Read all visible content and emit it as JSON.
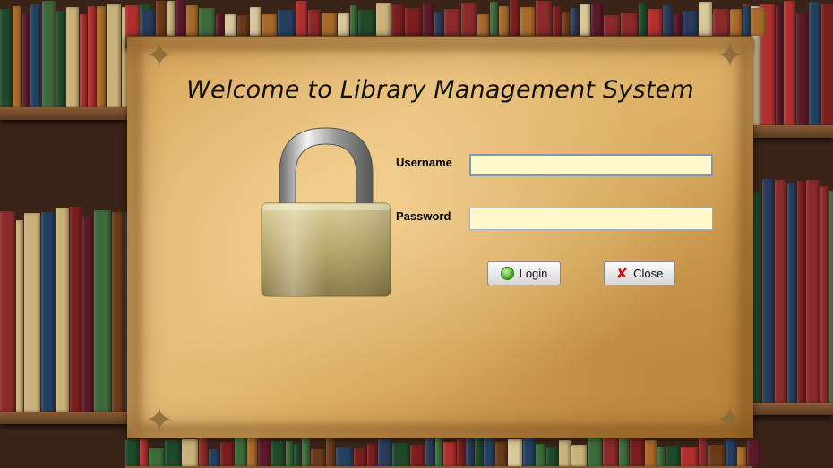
{
  "window": {
    "title": "Welcome to Library Management System"
  },
  "form": {
    "username_label": "Username",
    "username_value": "",
    "password_label": "Password",
    "password_value": ""
  },
  "buttons": {
    "login_label": "Login",
    "login_icon": "green-circle-icon",
    "close_label": "Close",
    "close_icon": "red-x-icon"
  },
  "colors": {
    "input_background": "#fff8c8",
    "parchment": "#dcae64",
    "title_text": "#111111"
  }
}
